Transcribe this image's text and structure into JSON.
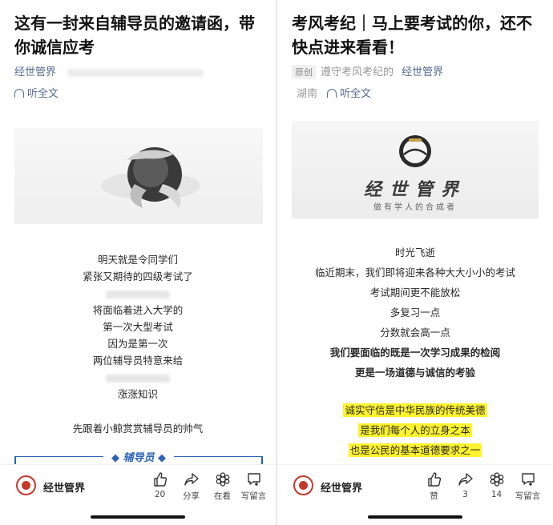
{
  "left": {
    "title": "这有一封来自辅导员的邀请函，带你诚信应考",
    "account": "经世管界",
    "listen_label": "听全文",
    "lines": [
      {
        "text": "明天就是令同学们",
        "style": "normal"
      },
      {
        "text": "紧张又期待的四级考试了",
        "style": "normal"
      },
      {
        "text": "",
        "style": "blur"
      },
      {
        "text": "将面临着进入大学的",
        "style": "normal"
      },
      {
        "text": "第一次大型考试",
        "style": "normal"
      },
      {
        "text": "因为是第一次",
        "style": "normal"
      },
      {
        "text": "两位辅导员特意来给",
        "style": "normal"
      },
      {
        "text": "",
        "style": "blur"
      },
      {
        "text": "涨涨知识",
        "style": "normal"
      },
      {
        "text": "",
        "style": "gap"
      },
      {
        "text": "先跟着小鲸赏赏辅导员的帅气",
        "style": "normal"
      }
    ],
    "section_label": "辅导员",
    "footer": {
      "account": "经世管界",
      "actions": [
        {
          "icon": "thumbs-up-icon",
          "label": "20"
        },
        {
          "icon": "share-icon",
          "label": "分享"
        },
        {
          "icon": "wow-icon",
          "label": "在看"
        },
        {
          "icon": "comment-icon",
          "label": "写留言"
        }
      ]
    }
  },
  "right": {
    "title": "考风考纪｜马上要考试的你，还不快点进来看看！",
    "original_badge": "原创",
    "column": "遵守考风考纪的",
    "account": "经世管界",
    "location": "湖南",
    "listen_label": "听全文",
    "banner_brand": "经世管界",
    "banner_slogan": "做有学人的合成者",
    "lines": [
      {
        "text": "时光飞逝",
        "style": "normal"
      },
      {
        "text": "临近期末，我们即将迎来各种大大小小的考试",
        "style": "normal"
      },
      {
        "text": "考试期间更不能放松",
        "style": "normal"
      },
      {
        "text": "多复习一点",
        "style": "normal"
      },
      {
        "text": "分数就会高一点",
        "style": "normal"
      },
      {
        "text": "我们要面临的既是一次学习成果的检阅",
        "style": "bold"
      },
      {
        "text": "更是一场道德与诚信的考验",
        "style": "bold"
      },
      {
        "text": "",
        "style": "gap"
      },
      {
        "text": "诚实守信是中华民族的传统美德",
        "style": "highlight"
      },
      {
        "text": "是我们每个人的立身之本",
        "style": "highlight"
      },
      {
        "text": "也是公民的基本道德要求之一",
        "style": "highlight"
      }
    ],
    "footer": {
      "account": "经世管界",
      "actions": [
        {
          "icon": "thumbs-up-icon",
          "label": "赞"
        },
        {
          "icon": "share-icon",
          "label": "3"
        },
        {
          "icon": "wow-icon",
          "label": "14"
        },
        {
          "icon": "comment-icon",
          "label": "写留言"
        }
      ]
    }
  },
  "colors": {
    "link": "#576b95",
    "highlight": "#fff32e",
    "section": "#2d63b8",
    "brand_red": "#c23a2b"
  }
}
